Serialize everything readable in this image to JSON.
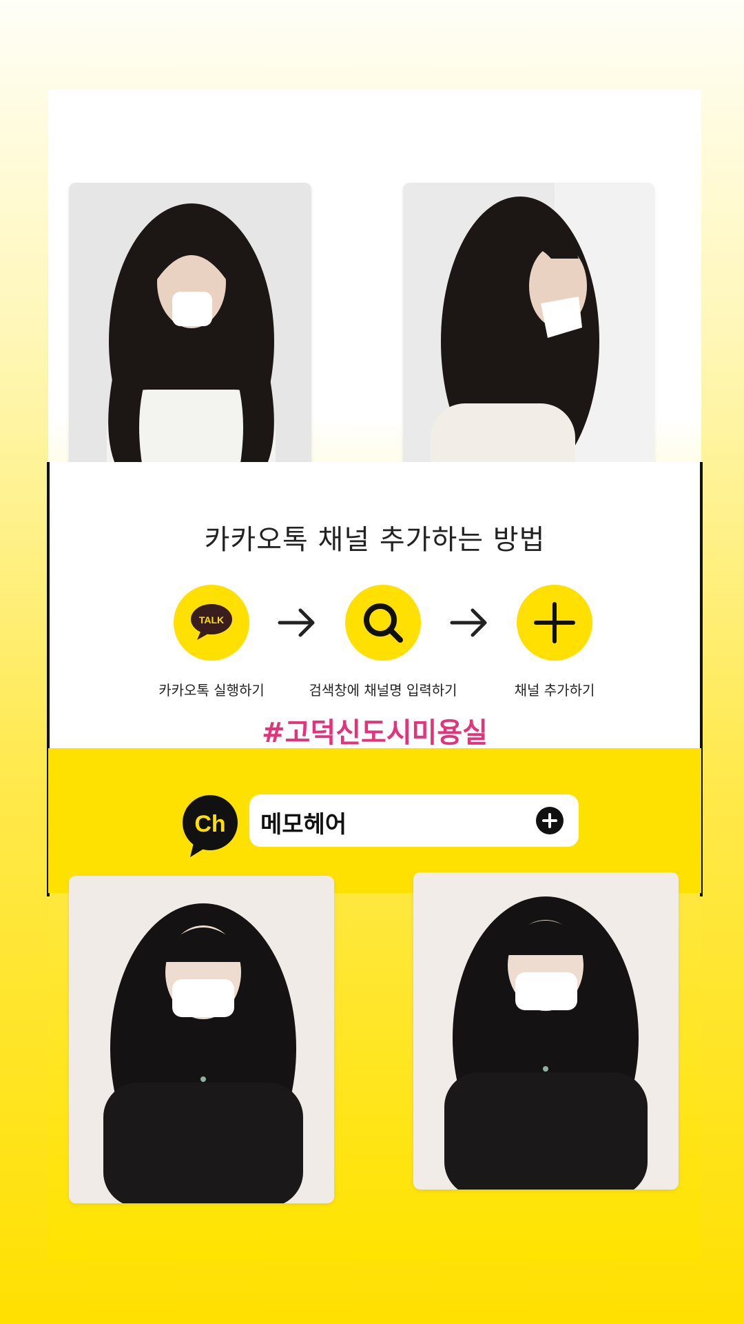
{
  "colors": {
    "accent_yellow": "#ffe000",
    "hashtag_pink": "#e3337a",
    "text_dark": "#222222"
  },
  "photos": [
    {
      "name": "photo-top-left",
      "subject": "long wavy dark hair, white top, mask"
    },
    {
      "name": "photo-top-right",
      "subject": "long layered dark hair, side view, white knit"
    },
    {
      "name": "photo-bottom-left",
      "subject": "long wavy black hair with bangs, black top, mask"
    },
    {
      "name": "photo-bottom-right",
      "subject": "long wavy black hair with bangs, black top, mask"
    }
  ],
  "guide": {
    "title": "카카오톡 채널 추가하는 방법",
    "steps": [
      {
        "icon": "talk-icon",
        "icon_text": "TALK",
        "label": "카카오톡 실행하기"
      },
      {
        "icon": "search-icon",
        "label": "검색창에 채널명 입력하기"
      },
      {
        "icon": "plus-icon",
        "label": "채널 추가하기"
      }
    ],
    "hashtag": "#고덕신도시미용실"
  },
  "channel_search": {
    "logo_text": "Ch",
    "query": "메모헤어",
    "action_icon": "add-circle-icon"
  }
}
